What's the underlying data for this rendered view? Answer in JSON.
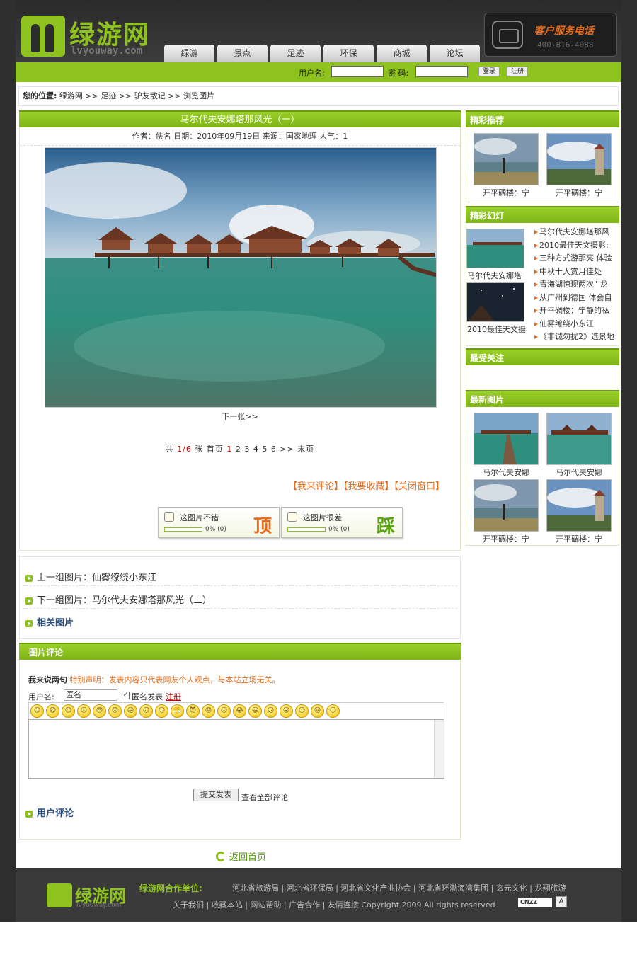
{
  "header": {
    "logo_text": "绿游网",
    "logo_sub": "lvyouway.com",
    "nav": [
      "绿游",
      "景点",
      "足迹",
      "环保",
      "商城",
      "论坛"
    ],
    "service_title": "客户服务电话",
    "service_phone": "400-816-4088"
  },
  "login": {
    "user_label": "用户名:",
    "pwd_label": "密 码:",
    "login_btn": "登录",
    "register_btn": "注册"
  },
  "breadcrumb": {
    "label": "您的位置:",
    "path": "绿游网 >> 足迹 >> 驴友散记 >> 浏览图片"
  },
  "article": {
    "title": "马尔代夫安娜塔那风光（一）",
    "meta": "作者：佚名   日期：2010年09月19日   来源：国家地理  人气：1",
    "next": "下一张>>",
    "pager_prefix": "共",
    "pager_cur": "1/6",
    "pager_mid": "张    首页",
    "pager_first": "1",
    "pager_rest": "2 3 4 5 6 >> 末页",
    "actions": "【我来评论】【我要收藏】【关闭窗口】"
  },
  "votes": {
    "up_text": "这图片不错",
    "up_value": 0,
    "up_stat": "0% (0)",
    "up_big": "顶",
    "down_text": "这图片很差",
    "down_value": 0,
    "down_stat": "0% (0)",
    "down_big": "踩"
  },
  "related": {
    "prev": "上一组图片：仙雾缭绕小东江",
    "next": "下一组图片：马尔代夫安娜塔那风光（二）",
    "title": "相关图片"
  },
  "comments": {
    "head": "图片评论",
    "say": "我来说两句",
    "notice": "特别声明：发表内容只代表网友个人观点，与本站立场无关。",
    "user_label": "用户名:",
    "user_value": "匿名",
    "anon_label": "匿名发表",
    "register": "注册",
    "emoticons": [
      "😊",
      "😋",
      "😍",
      "😐",
      "😎",
      "😲",
      "😜",
      "😖",
      "😏",
      "😤",
      "😈",
      "😡",
      "😮",
      "😂",
      "😃",
      "😕",
      "😝",
      "😶",
      "😫",
      "😏"
    ],
    "submit": "提交发表",
    "view_all": "查看全部评论",
    "user_comments": "用户评论"
  },
  "back_home": "返回首页",
  "sidebar": {
    "recommend": {
      "title": "精彩推荐",
      "items": [
        "开平碉楼：宁",
        "开平碉楼：宁"
      ]
    },
    "slides": {
      "title": "精彩幻灯",
      "thumbs": [
        "马尔代夫安娜塔",
        "2010最佳天文摄"
      ],
      "list": [
        "马尔代夫安娜塔那风",
        "2010最佳天文摄影:",
        "三种方式游那亮 体验",
        "中秋十大赏月佳处",
        "青海湖惊现两次\" 龙",
        "从广州到德国 体会自",
        "开平碉楼：宁静的私",
        "仙雾缭绕小东江",
        "《非诚勿扰2》选景地"
      ]
    },
    "focus": {
      "title": "最受关注"
    },
    "latest": {
      "title": "最新图片",
      "items": [
        "马尔代夫安娜",
        "马尔代夫安娜",
        "开平碉楼：宁",
        "开平碉楼：宁"
      ]
    }
  },
  "footer": {
    "logo_text": "绿游网",
    "logo_sub": "lvyouway.com",
    "partners_label": "绿游网合作单位:",
    "partners": "河北省旅游局 | 河北省环保局 | 河北省文化产业协会 | 河北省环渤海湾集团 | 玄元文化 | 龙翔旅游",
    "links": "关于我们 | 收藏本站 | 网站帮助 | 广告合作 | 友情连接   Copyright 2009 All rights reserved",
    "badge": "CNZZ"
  },
  "colors": {
    "accent": "#8dc21f",
    "orange": "#e86c1a"
  }
}
